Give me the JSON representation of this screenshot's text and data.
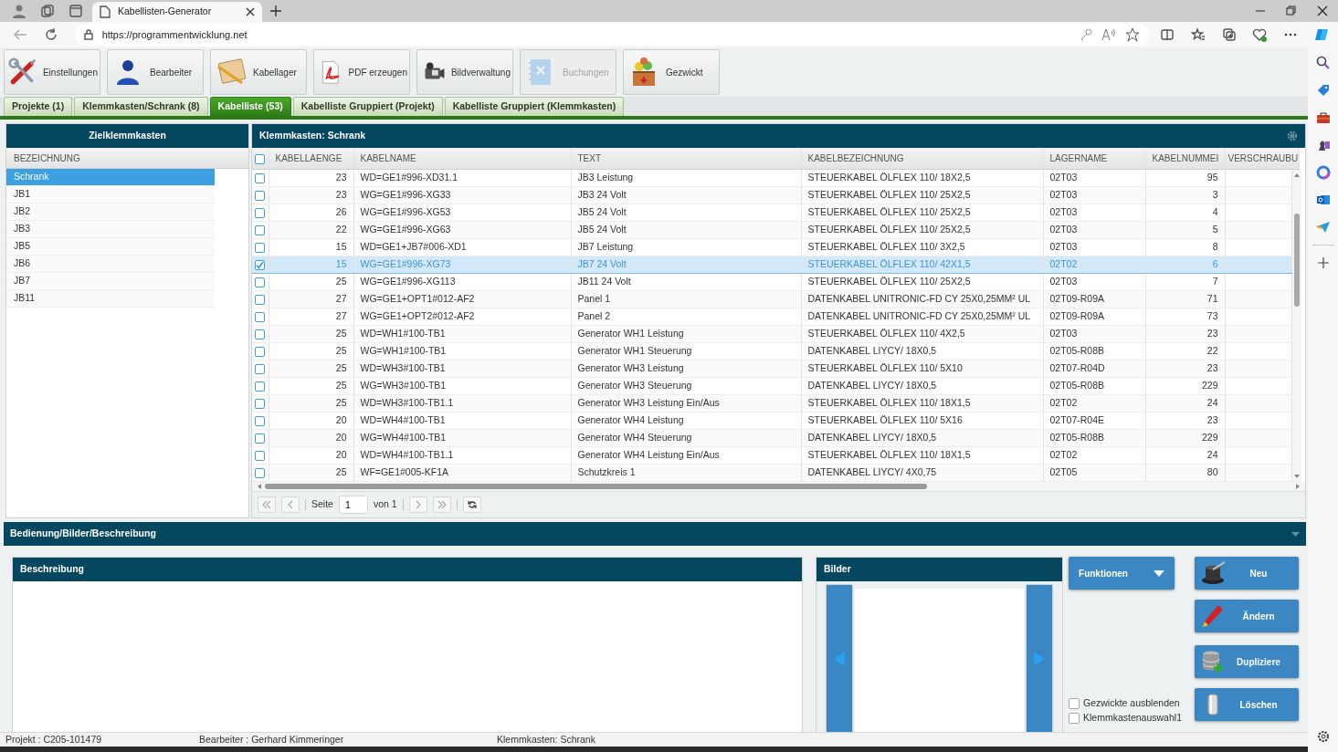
{
  "browser": {
    "tabs": [
      {
        "title": "Kabellisten-Generator",
        "selected": true
      }
    ],
    "url": "https://programmentwicklung.net"
  },
  "toolbar": [
    {
      "label": "Einstellungen",
      "disabled": false
    },
    {
      "label": "Bearbeiter",
      "disabled": false
    },
    {
      "label": "Kabellager",
      "disabled": false
    },
    {
      "label": "PDF erzeugen",
      "disabled": false
    },
    {
      "label": "Bildverwaltung",
      "disabled": false
    },
    {
      "label": "Buchungen",
      "disabled": true
    },
    {
      "label": "Gezwickt",
      "disabled": false
    }
  ],
  "tabs": [
    {
      "label": "Projekte (1)",
      "selected": false
    },
    {
      "label": "Klemmkasten/Schrank (8)",
      "selected": false
    },
    {
      "label": "Kabelliste (53)",
      "selected": true
    },
    {
      "label": "Kabelliste Gruppiert (Projekt)",
      "selected": false
    },
    {
      "label": "Kabelliste Gruppiert (Klemmkasten)",
      "selected": false
    }
  ],
  "left_panel": {
    "title": "Zielklemmkasten",
    "column": "BEZEICHNUNG",
    "items": [
      {
        "label": "Schrank",
        "selected": true
      },
      {
        "label": "JB1",
        "selected": false
      },
      {
        "label": "JB2",
        "selected": false
      },
      {
        "label": "JB3",
        "selected": false
      },
      {
        "label": "JB5",
        "selected": false
      },
      {
        "label": "JB6",
        "selected": false
      },
      {
        "label": "JB7",
        "selected": false
      },
      {
        "label": "JB11",
        "selected": false
      }
    ]
  },
  "grid": {
    "title": "Klemmkasten: Schrank",
    "select_all_checked": false,
    "columns": [
      "KABELLAENGE",
      "KABELNAME",
      "TEXT",
      "KABELBEZEICHNUNG",
      "LAGERNAME",
      "KABELNUMMEI",
      "VERSCHRAUBU"
    ],
    "rows": [
      {
        "checked": false,
        "selected": false,
        "cells": [
          "23",
          "WD=GE1#996-XD31.1",
          "JB3 Leistung",
          "STEUERKABEL ÖLFLEX 110/ 18X2,5",
          "02T03",
          "95"
        ]
      },
      {
        "checked": false,
        "selected": false,
        "cells": [
          "23",
          "WG=GE1#996-XG33",
          "JB3 24 Volt",
          "STEUERKABEL ÖLFLEX 110/ 25X2,5",
          "02T03",
          "3"
        ]
      },
      {
        "checked": false,
        "selected": false,
        "cells": [
          "26",
          "WG=GE1#996-XG53",
          "JB5 24 Volt",
          "STEUERKABEL ÖLFLEX 110/ 25X2,5",
          "02T03",
          "4"
        ]
      },
      {
        "checked": false,
        "selected": false,
        "cells": [
          "22",
          "WG=GE1#996-XG63",
          "JB5 24 Volt",
          "STEUERKABEL ÖLFLEX 110/ 25X2,5",
          "02T03",
          "5"
        ]
      },
      {
        "checked": false,
        "selected": false,
        "cells": [
          "15",
          "WD=GE1+JB7#006-XD1",
          "JB7 Leistung",
          "STEUERKABEL ÖLFLEX 110/ 3X2,5",
          "02T03",
          "8"
        ]
      },
      {
        "checked": true,
        "selected": true,
        "cells": [
          "15",
          "WG=GE1#996-XG73",
          "JB7 24 Volt",
          "STEUERKABEL ÖLFLEX 110/ 42X1,5",
          "02T02",
          "6"
        ]
      },
      {
        "checked": false,
        "selected": false,
        "cells": [
          "25",
          "WG=GE1#996-XG113",
          "JB11 24 Volt",
          "STEUERKABEL ÖLFLEX 110/ 25X2,5",
          "02T03",
          "7"
        ]
      },
      {
        "checked": false,
        "selected": false,
        "cells": [
          "27",
          "WG=GE1+OPT1#012-AF2",
          "Panel 1",
          "DATENKABEL UNITRONIC-FD CY 25X0,25MM² UL",
          "02T09-R09A",
          "71"
        ]
      },
      {
        "checked": false,
        "selected": false,
        "cells": [
          "27",
          "WG=GE1+OPT2#012-AF2",
          "Panel 2",
          "DATENKABEL UNITRONIC-FD CY 25X0,25MM² UL",
          "02T09-R09A",
          "73"
        ]
      },
      {
        "checked": false,
        "selected": false,
        "cells": [
          "25",
          "WD=WH1#100-TB1",
          "Generator WH1 Leistung",
          "STEUERKABEL ÖLFLEX 110/ 4X2,5",
          "02T03",
          "23"
        ]
      },
      {
        "checked": false,
        "selected": false,
        "cells": [
          "25",
          "WG=WH1#100-TB1",
          "Generator WH1 Steuerung",
          "DATENKABEL LIYCY/ 18X0,5",
          "02T05-R08B",
          "22"
        ]
      },
      {
        "checked": false,
        "selected": false,
        "cells": [
          "25",
          "WD=WH3#100-TB1",
          "Generator WH3 Leistung",
          "STEUERKABEL ÖLFLEX 110/ 5X10",
          "02T07-R04D",
          "23"
        ]
      },
      {
        "checked": false,
        "selected": false,
        "cells": [
          "25",
          "WG=WH3#100-TB1",
          "Generator WH3 Steuerung",
          "DATENKABEL LIYCY/ 18X0,5",
          "02T05-R08B",
          "229"
        ]
      },
      {
        "checked": false,
        "selected": false,
        "cells": [
          "25",
          "WD=WH3#100-TB1.1",
          "Generator WH3 Leistung Ein/Aus",
          "STEUERKABEL ÖLFLEX 110/ 18X1,5",
          "02T02",
          "24"
        ]
      },
      {
        "checked": false,
        "selected": false,
        "cells": [
          "20",
          "WD=WH4#100-TB1",
          "Generator WH4 Leistung",
          "STEUERKABEL ÖLFLEX 110/ 5X16",
          "02T07-R04E",
          "23"
        ]
      },
      {
        "checked": false,
        "selected": false,
        "cells": [
          "20",
          "WG=WH4#100-TB1",
          "Generator WH4 Steuerung",
          "DATENKABEL LIYCY/ 18X0,5",
          "02T05-R08B",
          "229"
        ]
      },
      {
        "checked": false,
        "selected": false,
        "cells": [
          "20",
          "WD=WH4#100-TB1.1",
          "Generator WH4 Leistung Ein/Aus",
          "STEUERKABEL ÖLFLEX 110/ 18X1,5",
          "02T02",
          "24"
        ]
      },
      {
        "checked": false,
        "selected": false,
        "cells": [
          "25",
          "WF=GE1#005-KF1A",
          "Schutzkreis 1",
          "DATENKABEL LIYCY/ 4X0,75",
          "02T05",
          "80"
        ]
      }
    ],
    "pager": {
      "page_label": "Seite",
      "page": "1",
      "total": "von 1"
    }
  },
  "bottom": {
    "title": "Bedienung/Bilder/Beschreibung",
    "description_title": "Beschreibung",
    "images_title": "Bilder",
    "functions_button": "Funktionen",
    "checkboxes": [
      {
        "label": "Gezwickte ausblenden",
        "checked": false
      },
      {
        "label": "Klemmkastenauswahl1",
        "checked": false
      }
    ],
    "actions": [
      "Neu",
      "Ändern",
      "Dupliziere",
      "Löschen"
    ]
  },
  "status_bar": [
    "Projekt : C205-101479",
    "Bearbeiter : Gerhard Kimmeringer",
    "Klemmkasten: Schrank"
  ]
}
